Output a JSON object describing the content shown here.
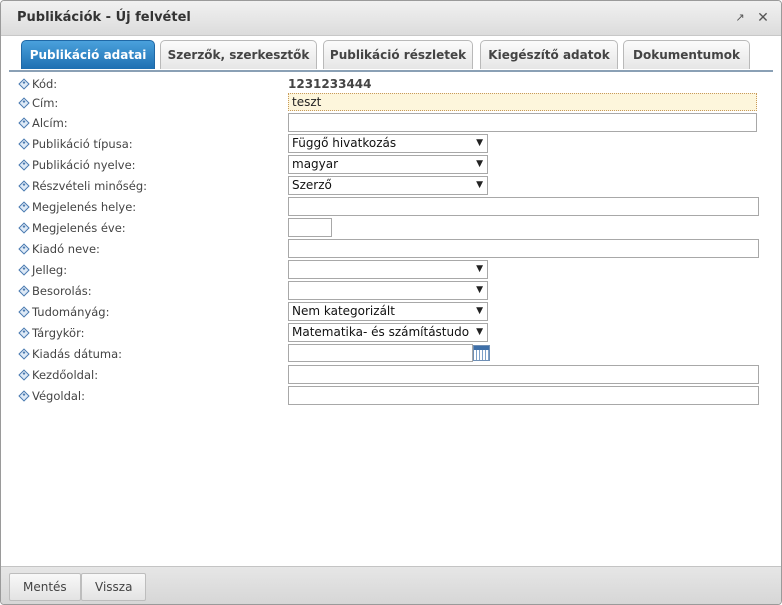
{
  "window": {
    "title": "Publikációk - Új felvétel"
  },
  "tabs": [
    {
      "label": "Publikáció adatai",
      "active": true
    },
    {
      "label": "Szerzők, szerkesztők",
      "active": false
    },
    {
      "label": "Publikáció részletek",
      "active": false
    },
    {
      "label": "Kiegészítő adatok",
      "active": false
    },
    {
      "label": "Dokumentumok",
      "active": false
    }
  ],
  "form": {
    "kod": {
      "label": "Kód:",
      "value": "1231233444"
    },
    "cim": {
      "label": "Cím:",
      "value": "teszt"
    },
    "alcim": {
      "label": "Alcím:",
      "value": ""
    },
    "tipus": {
      "label": "Publikáció típusa:",
      "value": "Függő hivatkozás"
    },
    "nyelv": {
      "label": "Publikáció nyelve:",
      "value": "magyar"
    },
    "minoseg": {
      "label": "Részvételi minőség:",
      "value": "Szerző"
    },
    "hely": {
      "label": "Megjelenés helye:",
      "value": ""
    },
    "ev": {
      "label": "Megjelenés éve:",
      "value": ""
    },
    "kiado": {
      "label": "Kiadó neve:",
      "value": ""
    },
    "jelleg": {
      "label": "Jelleg:",
      "value": ""
    },
    "besorolas": {
      "label": "Besorolás:",
      "value": ""
    },
    "tudomanyag": {
      "label": "Tudományág:",
      "value": "Nem kategorizált"
    },
    "targykor": {
      "label": "Tárgykör:",
      "value": "Matematika- és számítástudo"
    },
    "datum": {
      "label": "Kiadás dátuma:",
      "value": ""
    },
    "kezdo": {
      "label": "Kezdőoldal:",
      "value": ""
    },
    "veg": {
      "label": "Végoldal:",
      "value": ""
    }
  },
  "icons": {
    "popout": "popout-icon",
    "close": "close-icon",
    "calendar": "calendar-icon",
    "row_marker": "diamond-bullet-icon",
    "dropdown": "chevron-down-icon"
  },
  "footer": {
    "save_label": "Mentés",
    "back_label": "Vissza"
  },
  "colors": {
    "active_tab": "#2a7fc4",
    "highlight_field": "#fdf6dc"
  }
}
